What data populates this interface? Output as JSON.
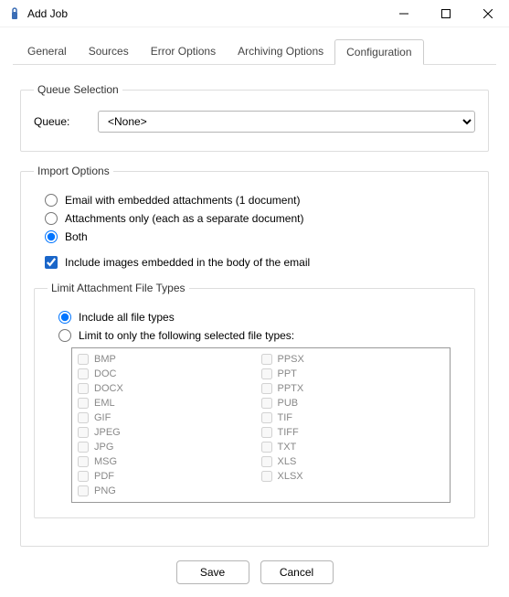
{
  "window": {
    "title": "Add Job"
  },
  "tabs": [
    {
      "label": "General"
    },
    {
      "label": "Sources"
    },
    {
      "label": "Error Options"
    },
    {
      "label": "Archiving Options"
    },
    {
      "label": "Configuration"
    }
  ],
  "queueSection": {
    "legend": "Queue Selection",
    "fieldLabel": "Queue:",
    "selected": "<None>"
  },
  "importSection": {
    "legend": "Import Options",
    "radios": {
      "email": "Email with embedded attachments (1 document)",
      "attachments": "Attachments only (each as a separate document)",
      "both": "Both"
    },
    "includeImages": "Include images embedded in the body of the email"
  },
  "limitSection": {
    "legend": "Limit Attachment File Types",
    "radios": {
      "all": "Include all file types",
      "limited": "Limit to only the following selected file types:"
    },
    "col1": [
      "BMP",
      "DOC",
      "DOCX",
      "EML",
      "GIF",
      "JPEG",
      "JPG",
      "MSG",
      "PDF",
      "PNG"
    ],
    "col2": [
      "PPSX",
      "PPT",
      "PPTX",
      "PUB",
      "TIF",
      "TIFF",
      "TXT",
      "XLS",
      "XLSX"
    ]
  },
  "footer": {
    "save": "Save",
    "cancel": "Cancel"
  }
}
